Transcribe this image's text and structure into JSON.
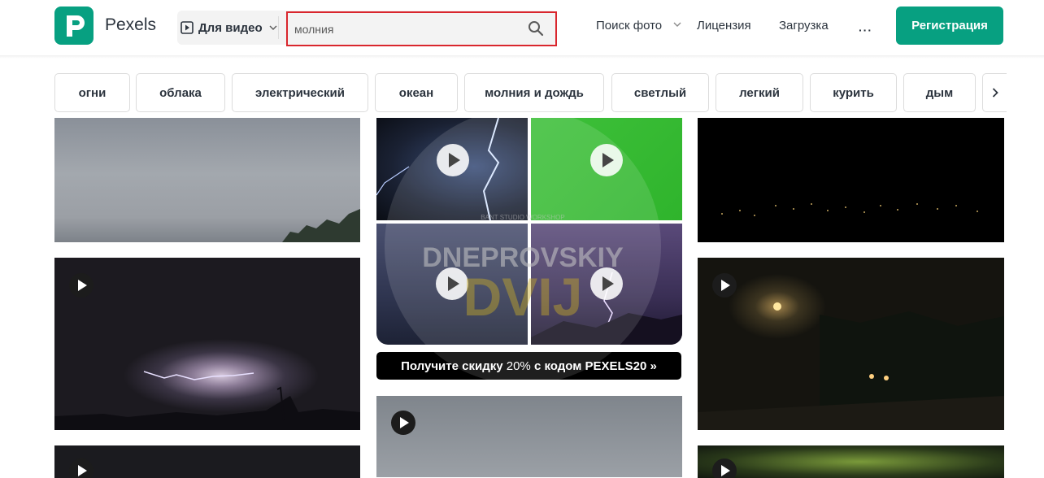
{
  "header": {
    "brand": "Pexels",
    "media_type": "Для видео",
    "search_value": "молния",
    "nav": {
      "photo_search": "Поиск фото",
      "license": "Лицензия",
      "upload": "Загрузка",
      "more": "···"
    },
    "signup": "Регистрация"
  },
  "tags": [
    "огни",
    "облака",
    "электрический",
    "океан",
    "молния и дождь",
    "светлый",
    "легкий",
    "курить",
    "дым"
  ],
  "ad": {
    "banner_prefix": "Получите скидку ",
    "banner_discount": "20%",
    "banner_suffix": " с кодом PEXELS20 »"
  },
  "watermark": {
    "line1": "DNEPROVSKIY",
    "line2": "DVIJ",
    "small": "BANT STUDIO WORKSHOP"
  },
  "colors": {
    "brand_green": "#07a081",
    "search_highlight": "#d9262d",
    "text": "#2c343e"
  },
  "icons": {
    "logo": "pexels-logo-icon",
    "video": "video-play-icon",
    "search": "search-icon",
    "more": "more-dots-icon",
    "next": "chevron-right-icon"
  }
}
